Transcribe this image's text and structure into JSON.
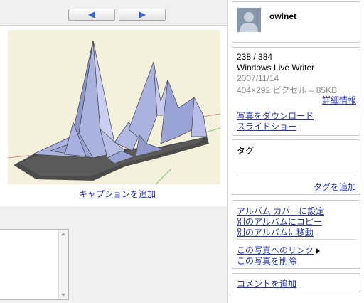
{
  "nav": {
    "prev_icon": "left-triangle-icon",
    "next_icon": "right-triangle-icon",
    "accent": "#3a5fd0"
  },
  "photo": {
    "caption_link": "キャプションを追加"
  },
  "user": {
    "name": "owlnet",
    "avatar_icon": "person-silhouette-icon"
  },
  "info": {
    "counter": "238 / 384",
    "title": "Windows Live Writer",
    "date": "2007/11/14",
    "details": "404×292 ピクセル – 85KB",
    "details_link": "詳細情報",
    "download": "写真をダウンロード",
    "slideshow": "スライドショー"
  },
  "tags": {
    "heading": "タグ",
    "add": "タグを追加"
  },
  "actions": {
    "set_cover": "アルバム カバーに設定",
    "copy": "別のアルバムにコピー",
    "move": "別のアルバムに移動",
    "link": "この写真へのリンク",
    "delete": "この写真を削除"
  },
  "comments": {
    "add": "コメントを追加"
  },
  "colors": {
    "link": "#2233bb",
    "frame_gray": "#f0f0f0"
  }
}
